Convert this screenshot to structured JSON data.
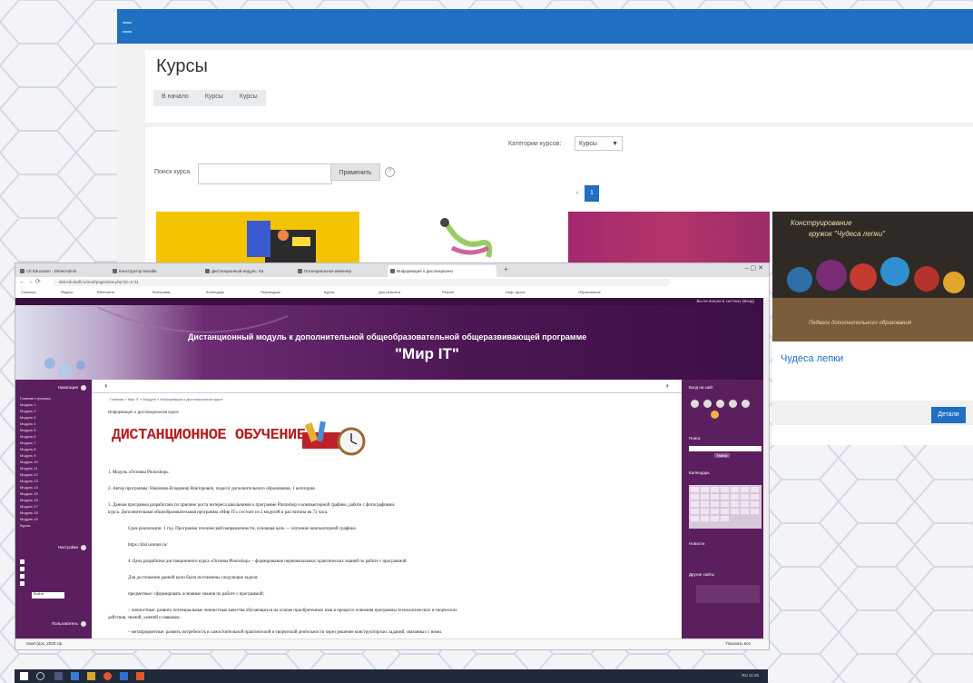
{
  "moodle": {
    "title": "Курсы",
    "breadcrumbs": [
      "В начало",
      "Курсы",
      "Курсы"
    ],
    "category_label": "Категории курсов:",
    "category_value": "Курсы",
    "search_label": "Поиск курса",
    "search_placeholder": "",
    "apply_button": "Применить",
    "help_icon": "?",
    "pagination": [
      "‹",
      "1"
    ]
  },
  "course_card": {
    "image_text_1": "Конструирование",
    "image_text_2": "кружок \"Чудеса лепки\"",
    "image_text_3": "Педагог дополнительного образования",
    "title": "Чудеса лепки",
    "button": "Детали"
  },
  "browser": {
    "tabs": [
      "Ctl Education - Dime/Admin",
      "Конструктор Moodle",
      "Дистанционный модуль: Ка",
      "Потенциальное инженер",
      "Информация о дистанционно"
    ],
    "url": "dist.edustaff.ru/mod/page/view.php?id=1711",
    "bookmarks": [
      "Сервисы",
      "Яндекс",
      "ВКонтакте",
      "Телеграмм",
      "Календарь",
      "Переводчик",
      "Курсы",
      "Для ремонта",
      "Разное",
      "Инф. курсы",
      "Образование"
    ]
  },
  "site": {
    "top_link": "Вы не вошли в систему (Вход)",
    "banner_title": "Дистанционный модуль к дополнительной общеобразовательной общеразвивающей программе",
    "banner_name": "\"Мир IT\"",
    "left_sidebar": {
      "heading": "Навигация",
      "items": [
        "Главная страница",
        "Модуль 1",
        "Модуль 2",
        "Модуль 3",
        "Модуль 4",
        "Модуль 5",
        "Модуль 6",
        "Модуль 7",
        "Модуль 8",
        "Модуль 9",
        "Модуль 10",
        "Модуль 11",
        "Модуль 12",
        "Модуль 13",
        "Модуль 14",
        "Модуль 15",
        "Модуль 16",
        "Модуль 17",
        "Модуль 18",
        "Модуль 19",
        "Курсы"
      ],
      "heading2": "Настройки",
      "heading3": "Пользователь",
      "button": "Войти"
    },
    "breadcrumb": "Главная » Мир IT » Модули » Информация о дистанционном курсе",
    "page_heading": "Информация о дистанционном курсе",
    "dist_title": "ДИСТАНЦИОННОЕ ОБУЧЕНИЕ",
    "paragraphs": [
      "1. Модуль «Основы Photoshop».",
      "2. Автор программы: Никонова Владимир Викторович, педагог дополнительного образования, 1 категория.",
      "3. Данная программа разработана по причине роста интереса школьников к программе Photoshop и компьютерной графике, работе с фотографиями.",
      "курса. Дополнительная общеобразовательная программа «Мир IT» состоит из 2 модулей и рассчитана на 72 часа.",
      "Срок реализации: 1 год. Программа технической направленности, основная цель — изучение компьютерной графики.",
      "https://dist.ucenter.ru/",
      "4. Цель разработки дистанционного курса «Основы Photoshop» – формирование первоначальных практических знаний по работе с программой.",
      "Для достижения данной цели были поставлены следующие задачи:",
      "предметные: сформировать основные знания по работе с программой;",
      "– личностные: развить потенциальные личностные качества обучающихся на основе приобретенных ими в процессе освоения программы технологических и творческих",
      "действия, знаний, умений и навыков;",
      "– метапредметные: развить потребность в самостоятельной практической и творческой деятельности через решение конструкторских заданий, связанных с ними."
    ],
    "right_sidebar": {
      "heading1": "Вход на сайт",
      "heading2": "Поиск",
      "search_button": "Найти",
      "heading3": "Календарь",
      "heading4": "Новости",
      "heading5": "Другие сайты"
    },
    "download_file": "пакет/док_2020.zip",
    "download_right": "Показать все"
  },
  "taskbar": {
    "tray": "RU  11:25"
  },
  "colors": {
    "moodle_blue": "#1f6fc3",
    "site_purple": "#5b1f5f",
    "title_red": "#b42020"
  }
}
